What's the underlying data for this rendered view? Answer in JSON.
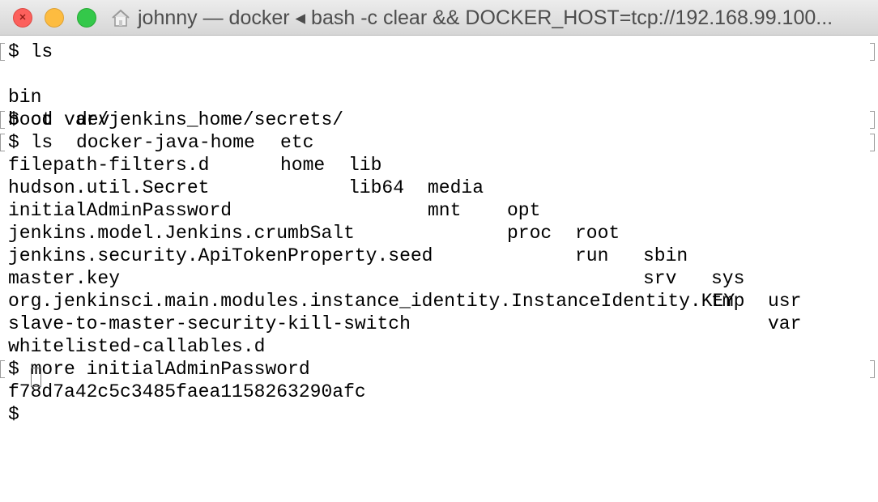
{
  "window": {
    "title": "johnny — docker ◂ bash -c clear && DOCKER_HOST=tcp://192.168.99.100..."
  },
  "terminal": {
    "commands": {
      "ls1": "$ ls",
      "cd": "$ cd var/jenkins_home/secrets/",
      "ls2": "$ ls",
      "more": "$ more initialAdminPassword",
      "prompt": "$ "
    },
    "root_listing": [
      [
        "bin",
        "dev",
        "etc",
        "lib",
        "media",
        "opt",
        "root",
        "sbin",
        "sys",
        "usr"
      ],
      [
        "boot",
        "docker-java-home",
        "home",
        "lib64",
        "mnt",
        "proc",
        "run",
        "srv",
        "tmp",
        "var"
      ]
    ],
    "secrets_listing": [
      "filepath-filters.d",
      "hudson.util.Secret",
      "initialAdminPassword",
      "jenkins.model.Jenkins.crumbSalt",
      "jenkins.security.ApiTokenProperty.seed",
      "master.key",
      "org.jenkinsci.main.modules.instance_identity.InstanceIdentity.KEY",
      "slave-to-master-security-kill-switch",
      "whitelisted-callables.d"
    ],
    "password_output": "f78d7a42c5c3485faea1158263290afc"
  }
}
